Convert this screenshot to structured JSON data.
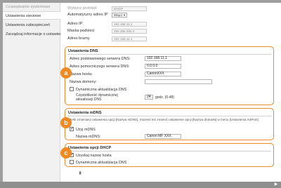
{
  "sidebar": {
    "items": [
      {
        "label": "Czasoptsanie systemowe"
      },
      {
        "label": "Ustawienia sieciowe"
      },
      {
        "label": "Ustawienia zabezpieczeń"
      },
      {
        "label": "Zarządzaj informacje o ustawieniach"
      }
    ]
  },
  "network": {
    "protocol_label": "Wybierz protokół",
    "protocol_value": "DHCP",
    "auto_ip_label": "Automatyczny adres IP",
    "auto_ip_value": "Włącz",
    "ip_label": "Adres IP",
    "ip_value": "192.168.11.1",
    "mask_label": "Maska podsieci",
    "mask_value": "255.255.255.0",
    "gateway_label": "Adres bramy",
    "gateway_value": "192.168.11.1"
  },
  "dns": {
    "title": "Ustawienia DNS",
    "primary_label": "Adres podstawowego serwera DNS:",
    "primary_value": "192.168.11.1",
    "secondary_label": "Adres pomocniczego serwera DNS:",
    "secondary_value": "0.0.0.0",
    "host_label": "Nazwa hosta:",
    "host_value": "CanonXXX",
    "domain_label": "Nazwa domeny:",
    "domain_value": "",
    "dynamic_label": "Dynamiczna aktualizacja DNS",
    "dynamic_checked": "",
    "interval_label_1": "Częstotliwość dynamicznej",
    "interval_label_2": "aktualizacji DNS",
    "interval_value": "24",
    "interval_unit": "godz. (0-48)"
  },
  "mdns": {
    "title": "Ustawienia mDNS",
    "note": "Jeśli zmieniasz ustawienia opcji [Nazwa mDNS], możesz też zmienić ustawienie opcji [Nazwa drukarki] w menu [Ustawienia AirPrint].",
    "use_label": "Użyj mDNS",
    "use_checked": "✓",
    "name_label": "Nazwa mDNS:",
    "name_value": "Canon MF XXX"
  },
  "dhcp": {
    "title": "Ustawienia opcji DHCP",
    "host_label": "Uzyskaj nazwę hosta",
    "host_checked": "✓",
    "dynamic_label": "Dynamiczna aktualizacja DNS",
    "dynamic_checked": ""
  },
  "badges": {
    "a": "a",
    "b": "b",
    "c": "c"
  },
  "colors": {
    "accent": "#ef8a24"
  }
}
